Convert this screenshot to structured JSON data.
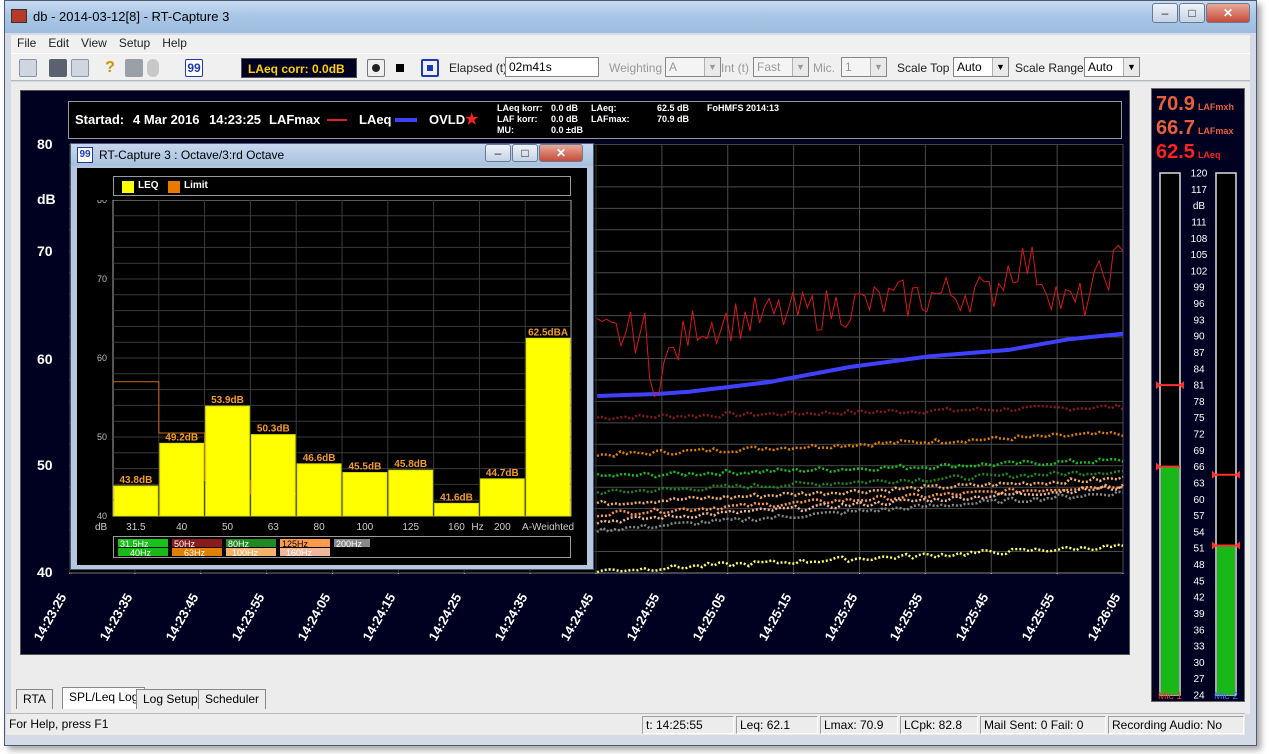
{
  "window": {
    "title": "db - 2014-03-12[8] - RT-Capture 3"
  },
  "menu": [
    "File",
    "Edit",
    "View",
    "Setup",
    "Help"
  ],
  "toolbar": {
    "laeq_corr": "LAeq corr: 0.0dB",
    "elapsed_label": "Elapsed (t)",
    "elapsed_value": "02m41s",
    "weighting_label": "Weighting",
    "weighting_value": "A",
    "int_label": "Int (t)",
    "int_value": "Fast",
    "mic_label": "Mic.",
    "mic_value": "1",
    "scale_top_label": "Scale Top",
    "scale_top_value": "Auto",
    "scale_range_label": "Scale Range",
    "scale_range_value": "Auto"
  },
  "info": {
    "startad": "Startad:",
    "date": "4 Mar 2016",
    "time": "14:23:25",
    "lafmax": "LAFmax",
    "laeq": "LAeq",
    "ovld": "OVLD",
    "laeq_korr_label": "LAeq korr:",
    "laeq_korr_value": "0.0 dB",
    "laf_korr_label": "LAF korr:",
    "laf_korr_value": "0.0 dB",
    "mu_label": "MU:",
    "mu_value": "0.0 ±dB",
    "laeq_label": "LAeq:",
    "laeq_value": "62.5 dB",
    "lafmax_label": "LAFmax:",
    "lafmax_value": "70.9 dB",
    "version": "FoHMFS 2014:13"
  },
  "main_axis": {
    "ylabels": [
      "80",
      "70",
      "60",
      "50",
      "40"
    ],
    "yunit": "dB",
    "xlabels": [
      "14:23:25",
      "14:23:35",
      "14:23:45",
      "14:23:55",
      "14:24:05",
      "14:24:15",
      "14:24:25",
      "14:24:35",
      "14:24:45",
      "14:24:55",
      "14:25:05",
      "14:25:15",
      "14:25:25",
      "14:25:35",
      "14:25:45",
      "14:25:55",
      "14:26:05"
    ]
  },
  "octave": {
    "title": "RT-Capture 3 : Octave/3:rd Octave",
    "legend": [
      "LEQ",
      "Limit"
    ],
    "yticks": [
      "80",
      "70",
      "60",
      "50",
      "40"
    ],
    "yunit": "dB",
    "hz_label": "Hz",
    "categories": [
      "31.5",
      "40",
      "50",
      "63",
      "80",
      "100",
      "125",
      "160",
      "200",
      "A-Weighted"
    ],
    "values": [
      43.8,
      49.2,
      53.9,
      50.3,
      46.6,
      45.5,
      45.8,
      41.6,
      44.7,
      62.5
    ],
    "value_labels": [
      "43.8dB",
      "49.2dB",
      "53.9dB",
      "50.3dB",
      "46.6dB",
      "45.5dB",
      "45.8dB",
      "41.6dB",
      "44.7dB",
      "62.5dBA"
    ],
    "band_legend_top": [
      "31.5Hz",
      "50Hz",
      "80Hz",
      "125Hz",
      "200Hz"
    ],
    "band_legend_bottom": [
      "40Hz",
      "63Hz",
      "100Hz",
      "160Hz"
    ]
  },
  "meter": {
    "big1_value": "70.9",
    "big1_unit": "LAFmxh",
    "big2_value": "66.7",
    "big2_unit": "LAFmax",
    "big3_value": "62.5",
    "big3_unit": "LAeq",
    "scale": [
      "120",
      "117",
      "dB",
      "111",
      "108",
      "105",
      "102",
      "99",
      "96",
      "93",
      "90",
      "87",
      "84",
      "81",
      "78",
      "75",
      "72",
      "69",
      "66",
      "63",
      "60",
      "57",
      "54",
      "51",
      "48",
      "45",
      "42",
      "39",
      "36",
      "33",
      "30",
      "27",
      "24"
    ],
    "mic1_label": "Mic 1",
    "mic2_label": "Mic 2",
    "mic1_level": 66.0,
    "mic2_level": 51.5
  },
  "tabs": [
    "RTA",
    "SPL/Leq Log",
    "Log Setup",
    "Scheduler"
  ],
  "status": {
    "help": "For Help, press F1",
    "time": "t: 14:25:55",
    "leq": "Leq: 62.1",
    "lmax": "Lmax: 70.9",
    "lcpk": "LCpk: 82.8",
    "mail": "Mail Sent: 0 Fail: 0",
    "recording": "Recording Audio: No"
  }
}
